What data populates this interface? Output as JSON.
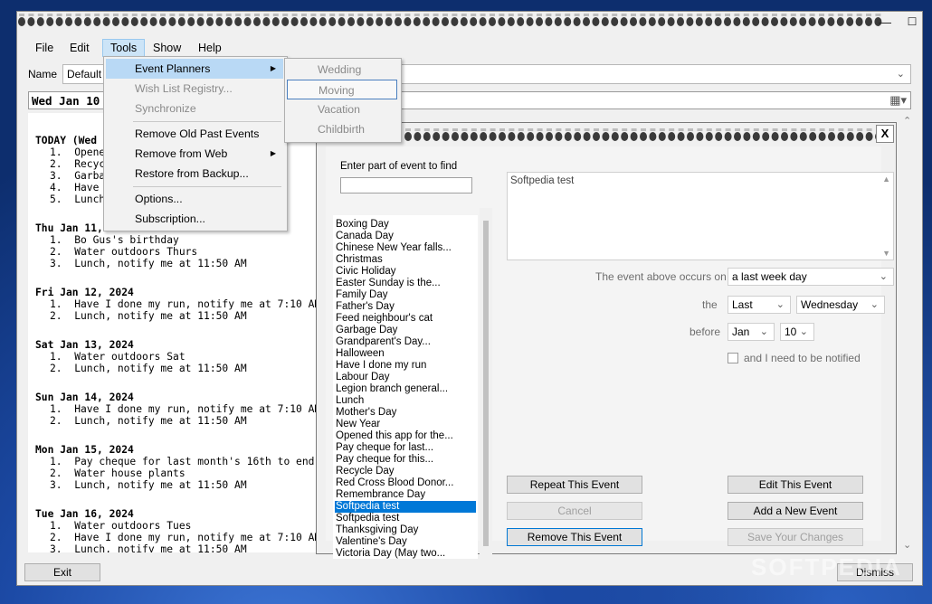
{
  "window": {
    "min_glyph": "—",
    "max_glyph": "☐",
    "close_glyph": "✕"
  },
  "menubar": [
    "File",
    "Edit",
    "Tools",
    "Show",
    "Help"
  ],
  "name_row": {
    "label": "Name",
    "value": "Default"
  },
  "date_line": "Wed  Jan 10",
  "agenda": [
    {
      "header": "TODAY (Wed",
      "items": [
        "1.  Opene",
        "2.  Recyc",
        "3.  Garba",
        "4.  Have I",
        "5.  Lunch,"
      ]
    },
    {
      "header": "Thu Jan 11,",
      "items": [
        "1.  Bo Gus's birthday",
        "2.  Water outdoors Thurs",
        "3.  Lunch, notify me at 11:50 AM"
      ]
    },
    {
      "header": "Fri Jan 12, 2024",
      "items": [
        "1.  Have I done my run, notify me at 7:10 AM",
        "2.  Lunch, notify me at 11:50 AM"
      ]
    },
    {
      "header": "Sat Jan 13, 2024",
      "items": [
        "1.  Water outdoors Sat",
        "2.  Lunch, notify me at 11:50 AM"
      ]
    },
    {
      "header": "Sun Jan 14, 2024",
      "items": [
        "1.  Have I done my run, notify me at 7:10 AM",
        "2.  Lunch, notify me at 11:50 AM"
      ]
    },
    {
      "header": "Mon Jan 15, 2024",
      "items": [
        "1.  Pay cheque for last month's 16th to end of mor",
        "2.  Water house plants",
        "3.  Lunch, notify me at 11:50 AM"
      ]
    },
    {
      "header": "Tue Jan 16, 2024",
      "items": [
        "1.  Water outdoors Tues",
        "2.  Have I done my run, notify me at 7:10 AM",
        "3.  Lunch, notify me at 11:50 AM"
      ]
    }
  ],
  "bottom": {
    "exit_label": "Exit",
    "dismiss_label": "Dismiss"
  },
  "tools_menu": {
    "items": [
      {
        "label": "Event Planners",
        "arrow": "▶",
        "highlighted": true
      },
      {
        "label": "Wish List Registry...",
        "disabled": true
      },
      {
        "label": "Synchronize",
        "disabled": true
      },
      {
        "label": "Remove Old Past Events"
      },
      {
        "label": "Remove from Web",
        "arrow": "▶"
      },
      {
        "label": "Restore from Backup..."
      },
      {
        "label": "Options..."
      },
      {
        "label": "Subscription..."
      }
    ]
  },
  "event_planners_submenu": [
    "Wedding",
    "Moving",
    "Vacation",
    "Childbirth"
  ],
  "dialog": {
    "close_glyph": "X",
    "find_label": "Enter part of event to find",
    "find_value": "",
    "events": [
      "Boxing Day",
      "Canada Day",
      "Chinese New Year falls...",
      "Christmas",
      "Civic Holiday",
      "Easter Sunday is the...",
      "Family Day",
      "Father's Day",
      "Feed neighbour's cat",
      "Garbage Day",
      "Grandparent's Day...",
      "Halloween",
      "Have I done my run",
      "Labour Day",
      "Legion branch general...",
      "Lunch",
      "Mother's Day",
      "New Year",
      "Opened this app for the...",
      "Pay cheque for last...",
      "Pay cheque for this...",
      "Recycle Day",
      "Red Cross Blood Donor...",
      "Remembrance Day",
      "Softpedia test",
      "Softpedia test",
      "Thanksgiving Day",
      "Valentine's Day",
      "Victoria Day (May two..."
    ],
    "selected_index": 24,
    "event_text": "Softpedia test",
    "occurs_label": "The event above occurs on",
    "occurs_value": "a last week day",
    "the_label": "the",
    "the_value": "Last",
    "weekday_value": "Wednesday",
    "before_label": "before",
    "month_value": "Jan",
    "day_value": "10",
    "notify_label": "and I need to be notified",
    "buttons": {
      "repeat": "Repeat This Event",
      "cancel": "Cancel",
      "remove": "Remove This Event",
      "edit": "Edit This Event",
      "add": "Add a New Event",
      "save": "Save Your Changes"
    }
  },
  "watermark": "SOFTPEDIA"
}
